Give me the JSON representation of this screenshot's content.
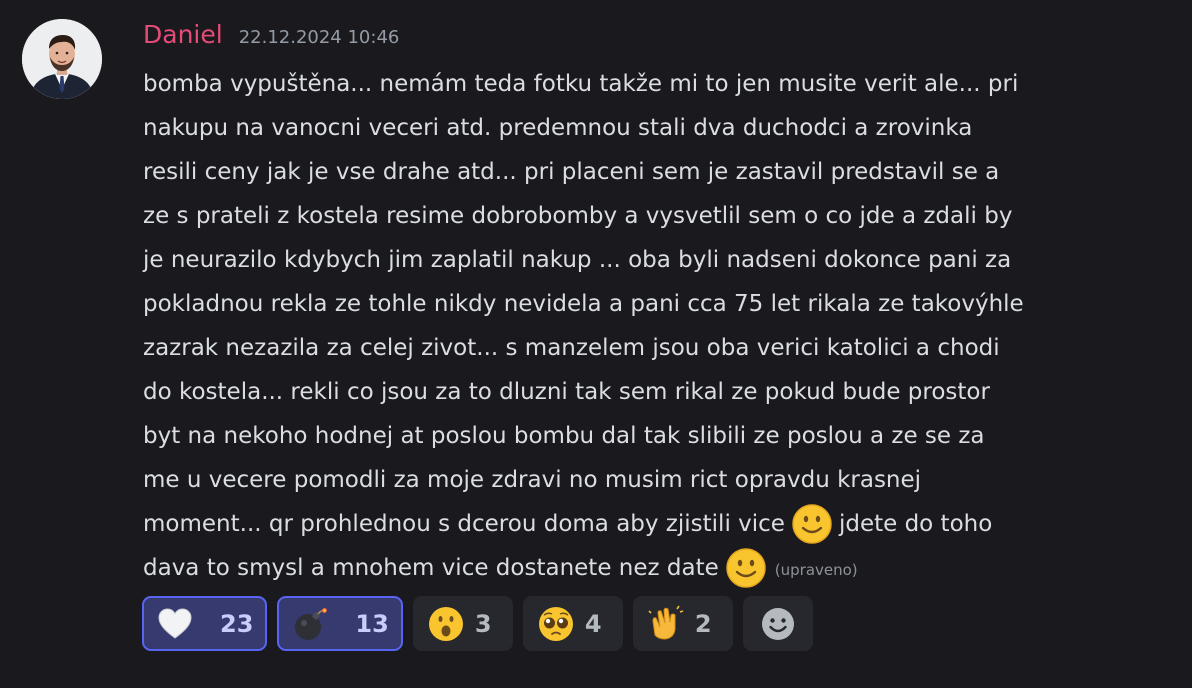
{
  "message": {
    "author": "Daniel",
    "timestamp": "22.12.2024 10:46",
    "lines": [
      "bomba vypuštěna... nemám teda fotku takže mi to jen musite verit ale... pri",
      "nakupu na vanocni veceri atd. predemnou stali dva duchodci a zrovinka",
      "resili ceny jak je vse drahe atd... pri placeni sem je zastavil predstavil se a",
      "ze s prateli z kostela resime dobrobomby a vysvetlil sem o co jde a zdali by",
      "je neurazilo kdybych jim zaplatil nakup ... oba byli nadseni dokonce pani za",
      "pokladnou rekla ze tohle nikdy nevidela a pani cca 75 let rikala ze takovýhle",
      "zazrak nezazila za celej zivot... s manzelem jsou oba verici katolici a chodi",
      "do kostela... rekli co jsou za to dluzni tak sem rikal ze pokud bude prostor",
      "byt na nekoho hodnej at poslou bombu dal tak slibili ze poslou a ze se za",
      "me u vecere pomodli za moje zdravi no musim rict opravdu krasnej"
    ],
    "line11_before": "moment... qr prohlednou s dcerou doma aby zjistili vice",
    "line11_after": "jdete do toho",
    "line12_before": "dava to smysl a mnohem vice dostanete nez date",
    "inline_emoji": "slightly-smiling-face",
    "edited": "(upraveno)"
  },
  "reactions": [
    {
      "emoji": "white-heart",
      "count": "23",
      "active": true
    },
    {
      "emoji": "bomb",
      "count": "13",
      "active": true
    },
    {
      "emoji": "face-with-open-mouth",
      "count": "3",
      "active": false
    },
    {
      "emoji": "pleading-face",
      "count": "4",
      "active": false
    },
    {
      "emoji": "clapping-hands",
      "count": "2",
      "active": false
    },
    {
      "emoji": "add-reaction",
      "count": "",
      "active": false
    }
  ],
  "colors": {
    "background": "#1a1a1e",
    "author": "#e64a76",
    "text": "#dbdee1",
    "timestamp": "#949ba4",
    "reaction_active_bg": "#363a6e",
    "reaction_active_border": "#5865f2",
    "reaction_bg": "#27282e"
  }
}
